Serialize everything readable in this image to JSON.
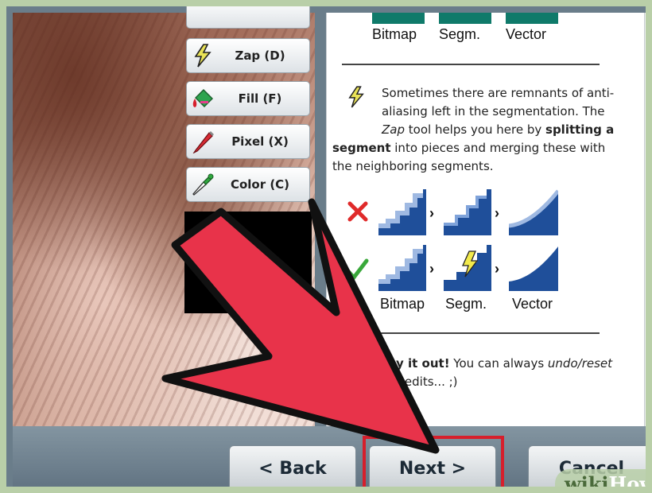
{
  "tools": [
    {
      "label": "Zap (D)",
      "icon": "lightning-icon"
    },
    {
      "label": "Fill (F)",
      "icon": "paint-bucket-icon"
    },
    {
      "label": "Pixel (X)",
      "icon": "pencil-icon"
    },
    {
      "label": "Color (C)",
      "icon": "eyedropper-icon"
    }
  ],
  "panel": {
    "top_labels": [
      "Bitmap",
      "Segm.",
      "Vector"
    ],
    "text1_a": "Sometimes there are remnants of anti-",
    "text1_b": "aliasing left in the segmentation. The",
    "text1_c_italic": "Zap",
    "text1_c_rest": " tool helps you here by ",
    "text1_c_bold": "splitting a",
    "text1_d_bold": "segment",
    "text1_d_rest": " into pieces and merging these with",
    "text1_e": "the neighboring segments.",
    "bottom_labels": [
      "Bitmap",
      "Segm.",
      "Vector"
    ],
    "text2_bold": "y it out!",
    "text2_rest": " You can always ",
    "text2_italic": "undo/reset",
    "text2_line2": "r edits... ;)"
  },
  "buttons": {
    "back": "< Back",
    "next": "Next >",
    "cancel": "Cancel"
  },
  "watermark": {
    "wiki": "wiki",
    "how": "How"
  },
  "colors": {
    "accent_green": "#0f7a6a",
    "highlight_red": "#d61f2c",
    "arrow_red": "#e8334a",
    "wrong_mark": "#e02a2a",
    "right_mark": "#39a83a"
  }
}
